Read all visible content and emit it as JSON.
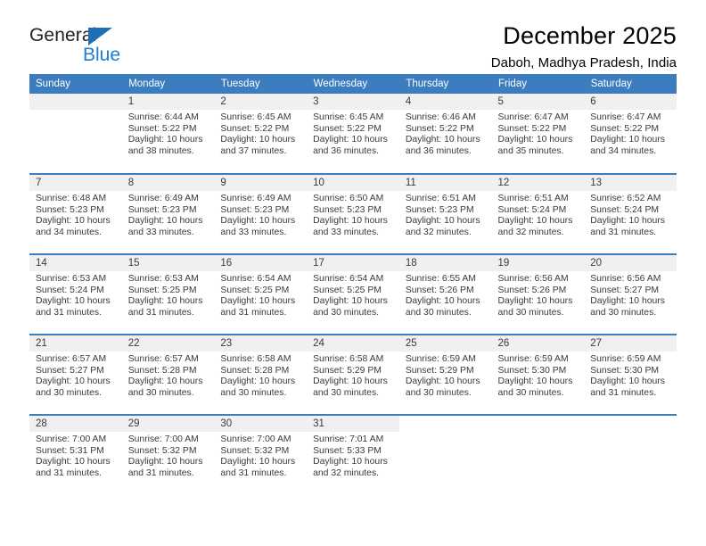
{
  "brand": {
    "name_top": "General",
    "name_bottom": "Blue",
    "triangle_icon": "triangle-icon",
    "color_dark": "#231f20",
    "color_blue": "#1d7fd1"
  },
  "header": {
    "title": "December 2025",
    "subtitle": "Daboh, Madhya Pradesh, India"
  },
  "theme": {
    "header_bg": "#3b7dbf",
    "header_text": "#ffffff",
    "daynum_bg": "#f0f0f0",
    "row_divider": "#3b7dbf",
    "body_text": "#3a3a3a"
  },
  "weekdays": [
    "Sunday",
    "Monday",
    "Tuesday",
    "Wednesday",
    "Thursday",
    "Friday",
    "Saturday"
  ],
  "labels": {
    "sunrise": "Sunrise:",
    "sunset": "Sunset:",
    "daylight": "Daylight:"
  },
  "weeks": [
    [
      {
        "day": "",
        "sunrise": "",
        "sunset": "",
        "daylight_1": "",
        "daylight_2": ""
      },
      {
        "day": "1",
        "sunrise": "Sunrise: 6:44 AM",
        "sunset": "Sunset: 5:22 PM",
        "daylight_1": "Daylight: 10 hours",
        "daylight_2": "and 38 minutes."
      },
      {
        "day": "2",
        "sunrise": "Sunrise: 6:45 AM",
        "sunset": "Sunset: 5:22 PM",
        "daylight_1": "Daylight: 10 hours",
        "daylight_2": "and 37 minutes."
      },
      {
        "day": "3",
        "sunrise": "Sunrise: 6:45 AM",
        "sunset": "Sunset: 5:22 PM",
        "daylight_1": "Daylight: 10 hours",
        "daylight_2": "and 36 minutes."
      },
      {
        "day": "4",
        "sunrise": "Sunrise: 6:46 AM",
        "sunset": "Sunset: 5:22 PM",
        "daylight_1": "Daylight: 10 hours",
        "daylight_2": "and 36 minutes."
      },
      {
        "day": "5",
        "sunrise": "Sunrise: 6:47 AM",
        "sunset": "Sunset: 5:22 PM",
        "daylight_1": "Daylight: 10 hours",
        "daylight_2": "and 35 minutes."
      },
      {
        "day": "6",
        "sunrise": "Sunrise: 6:47 AM",
        "sunset": "Sunset: 5:22 PM",
        "daylight_1": "Daylight: 10 hours",
        "daylight_2": "and 34 minutes."
      }
    ],
    [
      {
        "day": "7",
        "sunrise": "Sunrise: 6:48 AM",
        "sunset": "Sunset: 5:23 PM",
        "daylight_1": "Daylight: 10 hours",
        "daylight_2": "and 34 minutes."
      },
      {
        "day": "8",
        "sunrise": "Sunrise: 6:49 AM",
        "sunset": "Sunset: 5:23 PM",
        "daylight_1": "Daylight: 10 hours",
        "daylight_2": "and 33 minutes."
      },
      {
        "day": "9",
        "sunrise": "Sunrise: 6:49 AM",
        "sunset": "Sunset: 5:23 PM",
        "daylight_1": "Daylight: 10 hours",
        "daylight_2": "and 33 minutes."
      },
      {
        "day": "10",
        "sunrise": "Sunrise: 6:50 AM",
        "sunset": "Sunset: 5:23 PM",
        "daylight_1": "Daylight: 10 hours",
        "daylight_2": "and 33 minutes."
      },
      {
        "day": "11",
        "sunrise": "Sunrise: 6:51 AM",
        "sunset": "Sunset: 5:23 PM",
        "daylight_1": "Daylight: 10 hours",
        "daylight_2": "and 32 minutes."
      },
      {
        "day": "12",
        "sunrise": "Sunrise: 6:51 AM",
        "sunset": "Sunset: 5:24 PM",
        "daylight_1": "Daylight: 10 hours",
        "daylight_2": "and 32 minutes."
      },
      {
        "day": "13",
        "sunrise": "Sunrise: 6:52 AM",
        "sunset": "Sunset: 5:24 PM",
        "daylight_1": "Daylight: 10 hours",
        "daylight_2": "and 31 minutes."
      }
    ],
    [
      {
        "day": "14",
        "sunrise": "Sunrise: 6:53 AM",
        "sunset": "Sunset: 5:24 PM",
        "daylight_1": "Daylight: 10 hours",
        "daylight_2": "and 31 minutes."
      },
      {
        "day": "15",
        "sunrise": "Sunrise: 6:53 AM",
        "sunset": "Sunset: 5:25 PM",
        "daylight_1": "Daylight: 10 hours",
        "daylight_2": "and 31 minutes."
      },
      {
        "day": "16",
        "sunrise": "Sunrise: 6:54 AM",
        "sunset": "Sunset: 5:25 PM",
        "daylight_1": "Daylight: 10 hours",
        "daylight_2": "and 31 minutes."
      },
      {
        "day": "17",
        "sunrise": "Sunrise: 6:54 AM",
        "sunset": "Sunset: 5:25 PM",
        "daylight_1": "Daylight: 10 hours",
        "daylight_2": "and 30 minutes."
      },
      {
        "day": "18",
        "sunrise": "Sunrise: 6:55 AM",
        "sunset": "Sunset: 5:26 PM",
        "daylight_1": "Daylight: 10 hours",
        "daylight_2": "and 30 minutes."
      },
      {
        "day": "19",
        "sunrise": "Sunrise: 6:56 AM",
        "sunset": "Sunset: 5:26 PM",
        "daylight_1": "Daylight: 10 hours",
        "daylight_2": "and 30 minutes."
      },
      {
        "day": "20",
        "sunrise": "Sunrise: 6:56 AM",
        "sunset": "Sunset: 5:27 PM",
        "daylight_1": "Daylight: 10 hours",
        "daylight_2": "and 30 minutes."
      }
    ],
    [
      {
        "day": "21",
        "sunrise": "Sunrise: 6:57 AM",
        "sunset": "Sunset: 5:27 PM",
        "daylight_1": "Daylight: 10 hours",
        "daylight_2": "and 30 minutes."
      },
      {
        "day": "22",
        "sunrise": "Sunrise: 6:57 AM",
        "sunset": "Sunset: 5:28 PM",
        "daylight_1": "Daylight: 10 hours",
        "daylight_2": "and 30 minutes."
      },
      {
        "day": "23",
        "sunrise": "Sunrise: 6:58 AM",
        "sunset": "Sunset: 5:28 PM",
        "daylight_1": "Daylight: 10 hours",
        "daylight_2": "and 30 minutes."
      },
      {
        "day": "24",
        "sunrise": "Sunrise: 6:58 AM",
        "sunset": "Sunset: 5:29 PM",
        "daylight_1": "Daylight: 10 hours",
        "daylight_2": "and 30 minutes."
      },
      {
        "day": "25",
        "sunrise": "Sunrise: 6:59 AM",
        "sunset": "Sunset: 5:29 PM",
        "daylight_1": "Daylight: 10 hours",
        "daylight_2": "and 30 minutes."
      },
      {
        "day": "26",
        "sunrise": "Sunrise: 6:59 AM",
        "sunset": "Sunset: 5:30 PM",
        "daylight_1": "Daylight: 10 hours",
        "daylight_2": "and 30 minutes."
      },
      {
        "day": "27",
        "sunrise": "Sunrise: 6:59 AM",
        "sunset": "Sunset: 5:30 PM",
        "daylight_1": "Daylight: 10 hours",
        "daylight_2": "and 31 minutes."
      }
    ],
    [
      {
        "day": "28",
        "sunrise": "Sunrise: 7:00 AM",
        "sunset": "Sunset: 5:31 PM",
        "daylight_1": "Daylight: 10 hours",
        "daylight_2": "and 31 minutes."
      },
      {
        "day": "29",
        "sunrise": "Sunrise: 7:00 AM",
        "sunset": "Sunset: 5:32 PM",
        "daylight_1": "Daylight: 10 hours",
        "daylight_2": "and 31 minutes."
      },
      {
        "day": "30",
        "sunrise": "Sunrise: 7:00 AM",
        "sunset": "Sunset: 5:32 PM",
        "daylight_1": "Daylight: 10 hours",
        "daylight_2": "and 31 minutes."
      },
      {
        "day": "31",
        "sunrise": "Sunrise: 7:01 AM",
        "sunset": "Sunset: 5:33 PM",
        "daylight_1": "Daylight: 10 hours",
        "daylight_2": "and 32 minutes."
      },
      {
        "day": "",
        "sunrise": "",
        "sunset": "",
        "daylight_1": "",
        "daylight_2": ""
      },
      {
        "day": "",
        "sunrise": "",
        "sunset": "",
        "daylight_1": "",
        "daylight_2": ""
      },
      {
        "day": "",
        "sunrise": "",
        "sunset": "",
        "daylight_1": "",
        "daylight_2": ""
      }
    ]
  ]
}
